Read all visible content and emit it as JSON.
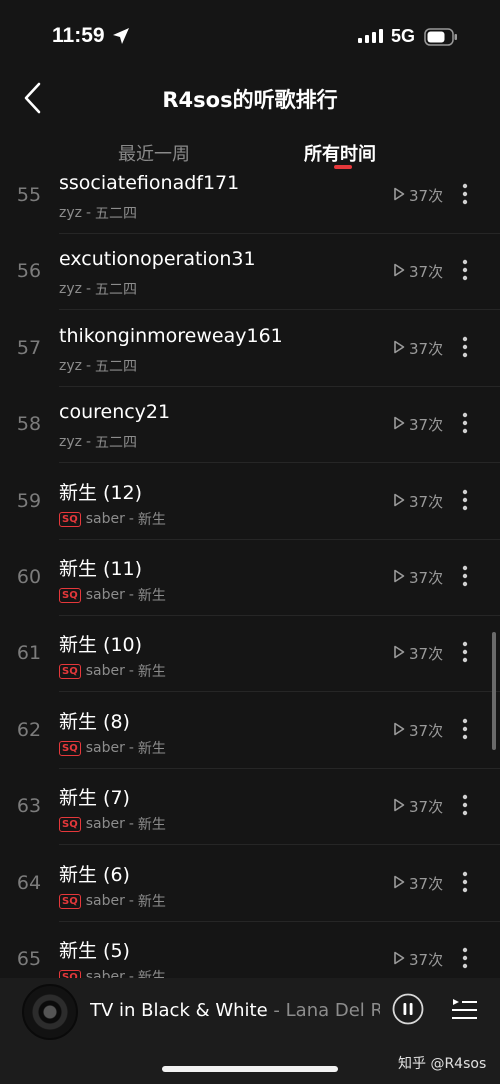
{
  "status": {
    "time": "11:59",
    "network": "5G"
  },
  "header": {
    "title": "R4sos的听歌排行"
  },
  "tabs": [
    {
      "label": "最近一周",
      "active": false
    },
    {
      "label": "所有时间",
      "active": true
    }
  ],
  "songs": [
    {
      "rank": "55",
      "title": "ssociatefionadf171",
      "artist": "zyz",
      "album": "五二四",
      "sq": false,
      "plays": "37次"
    },
    {
      "rank": "56",
      "title": "excutionoperation31",
      "artist": "zyz",
      "album": "五二四",
      "sq": false,
      "plays": "37次"
    },
    {
      "rank": "57",
      "title": "thikonginmoreweay161",
      "artist": "zyz",
      "album": "五二四",
      "sq": false,
      "plays": "37次"
    },
    {
      "rank": "58",
      "title": "courency21",
      "artist": "zyz",
      "album": "五二四",
      "sq": false,
      "plays": "37次"
    },
    {
      "rank": "59",
      "title": "新生 (12)",
      "artist": "saber",
      "album": "新生",
      "sq": true,
      "plays": "37次"
    },
    {
      "rank": "60",
      "title": "新生 (11)",
      "artist": "saber",
      "album": "新生",
      "sq": true,
      "plays": "37次"
    },
    {
      "rank": "61",
      "title": "新生 (10)",
      "artist": "saber",
      "album": "新生",
      "sq": true,
      "plays": "37次"
    },
    {
      "rank": "62",
      "title": "新生 (8)",
      "artist": "saber",
      "album": "新生",
      "sq": true,
      "plays": "37次"
    },
    {
      "rank": "63",
      "title": "新生 (7)",
      "artist": "saber",
      "album": "新生",
      "sq": true,
      "plays": "37次"
    },
    {
      "rank": "64",
      "title": "新生 (6)",
      "artist": "saber",
      "album": "新生",
      "sq": true,
      "plays": "37次"
    },
    {
      "rank": "65",
      "title": "新生 (5)",
      "artist": "saber",
      "album": "新生",
      "sq": true,
      "plays": "37次"
    }
  ],
  "badge_text": "SQ",
  "separator": "-",
  "player": {
    "title": "TV in Black & White",
    "separator": "-",
    "artist": "Lana Del Rey"
  },
  "watermark": "知乎 @R4sos",
  "colors": {
    "accent": "#e5383b",
    "background": "#151515"
  }
}
